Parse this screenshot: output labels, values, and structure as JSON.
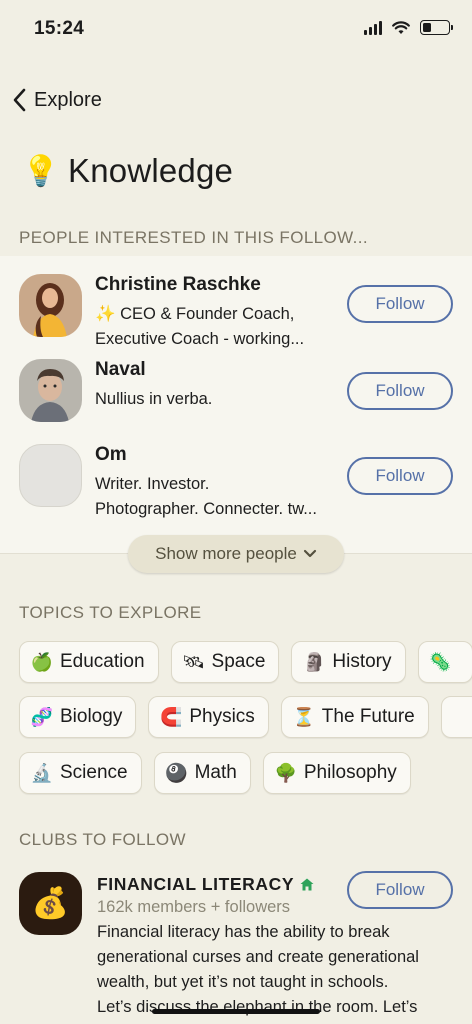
{
  "status": {
    "time": "15:24",
    "battery_level": 0.35
  },
  "nav": {
    "back_label": "Explore"
  },
  "page": {
    "title_emoji": "💡",
    "title": "Knowledge"
  },
  "people": {
    "header": "PEOPLE INTERESTED IN THIS FOLLOW...",
    "items": [
      {
        "name": "Christine Raschke",
        "bio_line1": "✨ CEO & Founder Coach,",
        "bio_line2": "Executive Coach - working...",
        "follow_label": "Follow"
      },
      {
        "name": "Naval",
        "bio_line1": "Nullius in verba.",
        "bio_line2": "",
        "follow_label": "Follow"
      },
      {
        "name": "Om",
        "bio_line1": "Writer. Investor.",
        "bio_line2": "Photographer. Connecter. tw...",
        "follow_label": "Follow"
      }
    ],
    "show_more_label": "Show more people"
  },
  "topics": {
    "header": "TOPICS TO EXPLORE",
    "row1": [
      {
        "emoji": "🍏",
        "label": "Education"
      },
      {
        "emoji": "🛰",
        "label": "Space"
      },
      {
        "emoji": "🗿",
        "label": "History"
      },
      {
        "emoji": "🦠",
        "label": ""
      }
    ],
    "row2": [
      {
        "emoji": "🧬",
        "label": "Biology"
      },
      {
        "emoji": "🧲",
        "label": "Physics"
      },
      {
        "emoji": "⏳",
        "label": "The Future"
      }
    ],
    "row3": [
      {
        "emoji": "🔬",
        "label": "Science"
      },
      {
        "emoji": "🎱",
        "label": "Math"
      },
      {
        "emoji": "🌳",
        "label": "Philosophy"
      }
    ]
  },
  "clubs": {
    "header": "CLUBS TO FOLLOW",
    "items": [
      {
        "emoji": "💰",
        "name": "FINANCIAL LITERACY",
        "meta": "162k members + followers",
        "desc_line1": "Financial literacy has the ability to break",
        "desc_line2": "generational curses and create generational",
        "desc_line3": "wealth, but yet it’s not taught in schools.",
        "desc_line4": "Let’s discuss the elephant in the room. Let’s",
        "follow_label": "Follow"
      }
    ]
  },
  "colors": {
    "background": "#f1efe4",
    "accent": "#5671a8",
    "muted": "#7a7464",
    "club_home": "#2fa35a"
  }
}
